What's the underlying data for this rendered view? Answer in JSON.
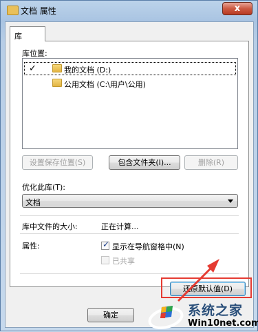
{
  "window": {
    "title": "文档 属性",
    "close_label": "x"
  },
  "tabs": [
    {
      "label": "库"
    }
  ],
  "library": {
    "locations_label": "库位置:",
    "items": [
      {
        "label": "我的文档 (D:)",
        "checked": true,
        "check": "✓"
      },
      {
        "label": "公用文档 (C:\\用户\\公用)",
        "checked": false
      }
    ],
    "buttons": {
      "set_save_location": "设置保存位置(S)",
      "include_folder": "包含文件夹(I)...",
      "remove": "删除(R)"
    }
  },
  "optimize": {
    "label": "优化此库(T):",
    "value": "文档"
  },
  "size": {
    "label": "库中文件的大小:",
    "value": "正在计算..."
  },
  "attributes": {
    "label": "属性:",
    "show_in_nav": {
      "label": "显示在导航窗格中(N)",
      "checked": true,
      "check": "✓"
    },
    "shared": {
      "label": "已共享",
      "checked": false
    }
  },
  "restore_defaults": "还原默认值(D)",
  "footer": {
    "ok": "确定"
  },
  "watermark": {
    "title": "系统之家",
    "url": "Win10net.com"
  },
  "colors": {
    "highlight": "#e53b32",
    "window_frame": "#a9c4e2"
  }
}
